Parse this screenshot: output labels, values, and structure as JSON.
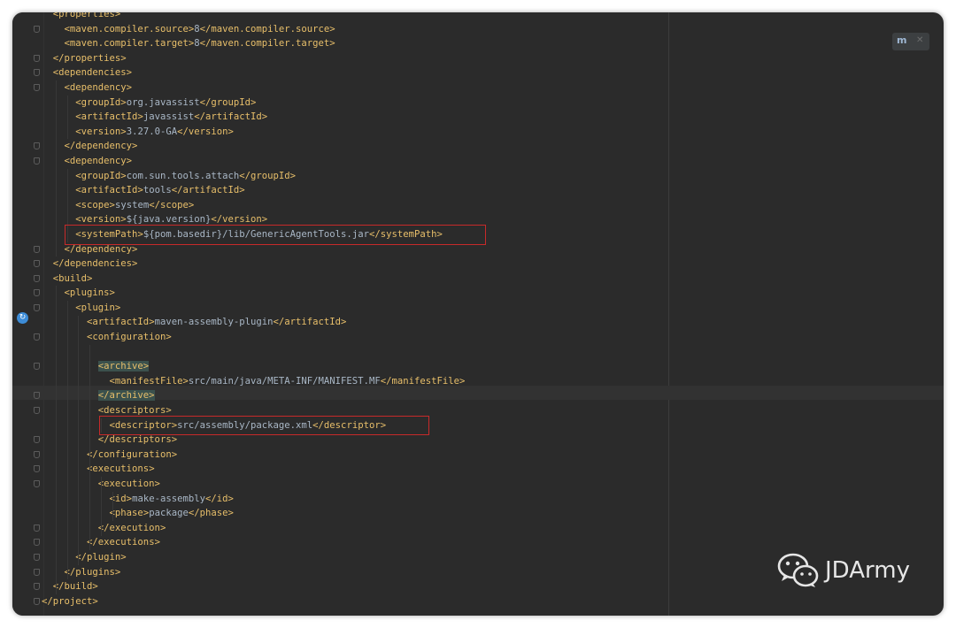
{
  "editor": {
    "lines": [
      {
        "indent": 2,
        "parts": [
          [
            "tag",
            "<properties>"
          ]
        ]
      },
      {
        "indent": 4,
        "parts": [
          [
            "tag",
            "<maven.compiler.source>"
          ],
          [
            "txt",
            "8"
          ],
          [
            "tag",
            "</maven.compiler.source>"
          ]
        ]
      },
      {
        "indent": 4,
        "parts": [
          [
            "tag",
            "<maven.compiler.target>"
          ],
          [
            "txt",
            "8"
          ],
          [
            "tag",
            "</maven.compiler.target>"
          ]
        ]
      },
      {
        "indent": 2,
        "parts": [
          [
            "tag",
            "</properties>"
          ]
        ]
      },
      {
        "indent": 2,
        "parts": [
          [
            "tag",
            "<dependencies>"
          ]
        ]
      },
      {
        "indent": 4,
        "parts": [
          [
            "tag",
            "<dependency>"
          ]
        ]
      },
      {
        "indent": 6,
        "parts": [
          [
            "tag",
            "<groupId>"
          ],
          [
            "txt",
            "org.javassist"
          ],
          [
            "tag",
            "</groupId>"
          ]
        ]
      },
      {
        "indent": 6,
        "parts": [
          [
            "tag",
            "<artifactId>"
          ],
          [
            "txt",
            "javassist"
          ],
          [
            "tag",
            "</artifactId>"
          ]
        ]
      },
      {
        "indent": 6,
        "parts": [
          [
            "tag",
            "<version>"
          ],
          [
            "txt",
            "3.27.0-GA"
          ],
          [
            "tag",
            "</version>"
          ]
        ]
      },
      {
        "indent": 4,
        "parts": [
          [
            "tag",
            "</dependency>"
          ]
        ]
      },
      {
        "indent": 4,
        "parts": [
          [
            "tag",
            "<dependency>"
          ]
        ]
      },
      {
        "indent": 6,
        "parts": [
          [
            "tag",
            "<groupId>"
          ],
          [
            "txt",
            "com.sun.tools.attach"
          ],
          [
            "tag",
            "</groupId>"
          ]
        ]
      },
      {
        "indent": 6,
        "parts": [
          [
            "tag",
            "<artifactId>"
          ],
          [
            "txt",
            "tools"
          ],
          [
            "tag",
            "</artifactId>"
          ]
        ]
      },
      {
        "indent": 6,
        "parts": [
          [
            "tag",
            "<scope>"
          ],
          [
            "txt",
            "system"
          ],
          [
            "tag",
            "</scope>"
          ]
        ]
      },
      {
        "indent": 6,
        "parts": [
          [
            "tag",
            "<version>"
          ],
          [
            "txt",
            "${java.version}"
          ],
          [
            "tag",
            "</version>"
          ]
        ]
      },
      {
        "indent": 6,
        "parts": [
          [
            "tag",
            "<systemPath>"
          ],
          [
            "txt",
            "${pom.basedir}/lib/GenericAgentTools.jar"
          ],
          [
            "tag",
            "</systemPath>"
          ]
        ]
      },
      {
        "indent": 4,
        "parts": [
          [
            "tag",
            "</dependency>"
          ]
        ]
      },
      {
        "indent": 2,
        "parts": [
          [
            "tag",
            "</dependencies>"
          ]
        ]
      },
      {
        "indent": 2,
        "parts": [
          [
            "tag",
            "<build>"
          ]
        ]
      },
      {
        "indent": 4,
        "parts": [
          [
            "tag",
            "<plugins>"
          ]
        ]
      },
      {
        "indent": 6,
        "parts": [
          [
            "tag",
            "<plugin>"
          ]
        ]
      },
      {
        "indent": 8,
        "parts": [
          [
            "tag",
            "<artifactId>"
          ],
          [
            "txt",
            "maven-assembly-plugin"
          ],
          [
            "tag",
            "</artifactId>"
          ]
        ]
      },
      {
        "indent": 8,
        "parts": [
          [
            "tag",
            "<configuration>"
          ]
        ]
      },
      {
        "indent": 0,
        "parts": []
      },
      {
        "indent": 10,
        "parts": [
          [
            "taghl",
            "<archive>"
          ]
        ]
      },
      {
        "indent": 12,
        "parts": [
          [
            "tag",
            "<manifestFile>"
          ],
          [
            "txt",
            "src/main/java/META-INF/MANIFEST.MF"
          ],
          [
            "tag",
            "</manifestFile>"
          ]
        ]
      },
      {
        "indent": 10,
        "parts": [
          [
            "taghl",
            "</archive>"
          ]
        ]
      },
      {
        "indent": 10,
        "parts": [
          [
            "tag",
            "<descriptors>"
          ]
        ]
      },
      {
        "indent": 12,
        "parts": [
          [
            "tag",
            "<descriptor>"
          ],
          [
            "txt",
            "src/assembly/package.xml"
          ],
          [
            "tag",
            "</descriptor>"
          ]
        ]
      },
      {
        "indent": 10,
        "parts": [
          [
            "tag",
            "</descriptors>"
          ]
        ]
      },
      {
        "indent": 8,
        "parts": [
          [
            "tag",
            "</configuration>"
          ]
        ]
      },
      {
        "indent": 8,
        "parts": [
          [
            "tag",
            "<executions>"
          ]
        ]
      },
      {
        "indent": 10,
        "parts": [
          [
            "tag",
            "<execution>"
          ]
        ]
      },
      {
        "indent": 12,
        "parts": [
          [
            "tag",
            "<id>"
          ],
          [
            "txt",
            "make-assembly"
          ],
          [
            "tag",
            "</id>"
          ]
        ]
      },
      {
        "indent": 12,
        "parts": [
          [
            "tag",
            "<phase>"
          ],
          [
            "txt",
            "package"
          ],
          [
            "tag",
            "</phase>"
          ]
        ]
      },
      {
        "indent": 10,
        "parts": [
          [
            "tag",
            "</execution>"
          ]
        ]
      },
      {
        "indent": 8,
        "parts": [
          [
            "tag",
            "</executions>"
          ]
        ]
      },
      {
        "indent": 6,
        "parts": [
          [
            "tag",
            "</plugin>"
          ]
        ]
      },
      {
        "indent": 4,
        "parts": [
          [
            "tag",
            "</plugins>"
          ]
        ]
      },
      {
        "indent": 2,
        "parts": [
          [
            "tag",
            "</build>"
          ]
        ]
      },
      {
        "indent": 0,
        "parts": [
          [
            "tag",
            "</project>"
          ]
        ]
      }
    ],
    "fold_lines": [
      1,
      3,
      4,
      5,
      9,
      10,
      16,
      17,
      18,
      19,
      20,
      22,
      24,
      26,
      27,
      29,
      30,
      31,
      32,
      35,
      36,
      37,
      38,
      39,
      40
    ],
    "highlighted_lines": [
      15,
      28
    ],
    "colors": {
      "background": "#2b2b2b",
      "tag": "#e8bf6a",
      "text": "#a9b7c6",
      "highlight_box": "#c72a2a"
    }
  },
  "icons": {
    "gutter": "maven-run-icon",
    "badge": "maven-icon",
    "badge_close": "close-icon"
  },
  "watermark": {
    "icon": "wechat-icon",
    "label": "JDArmy"
  }
}
